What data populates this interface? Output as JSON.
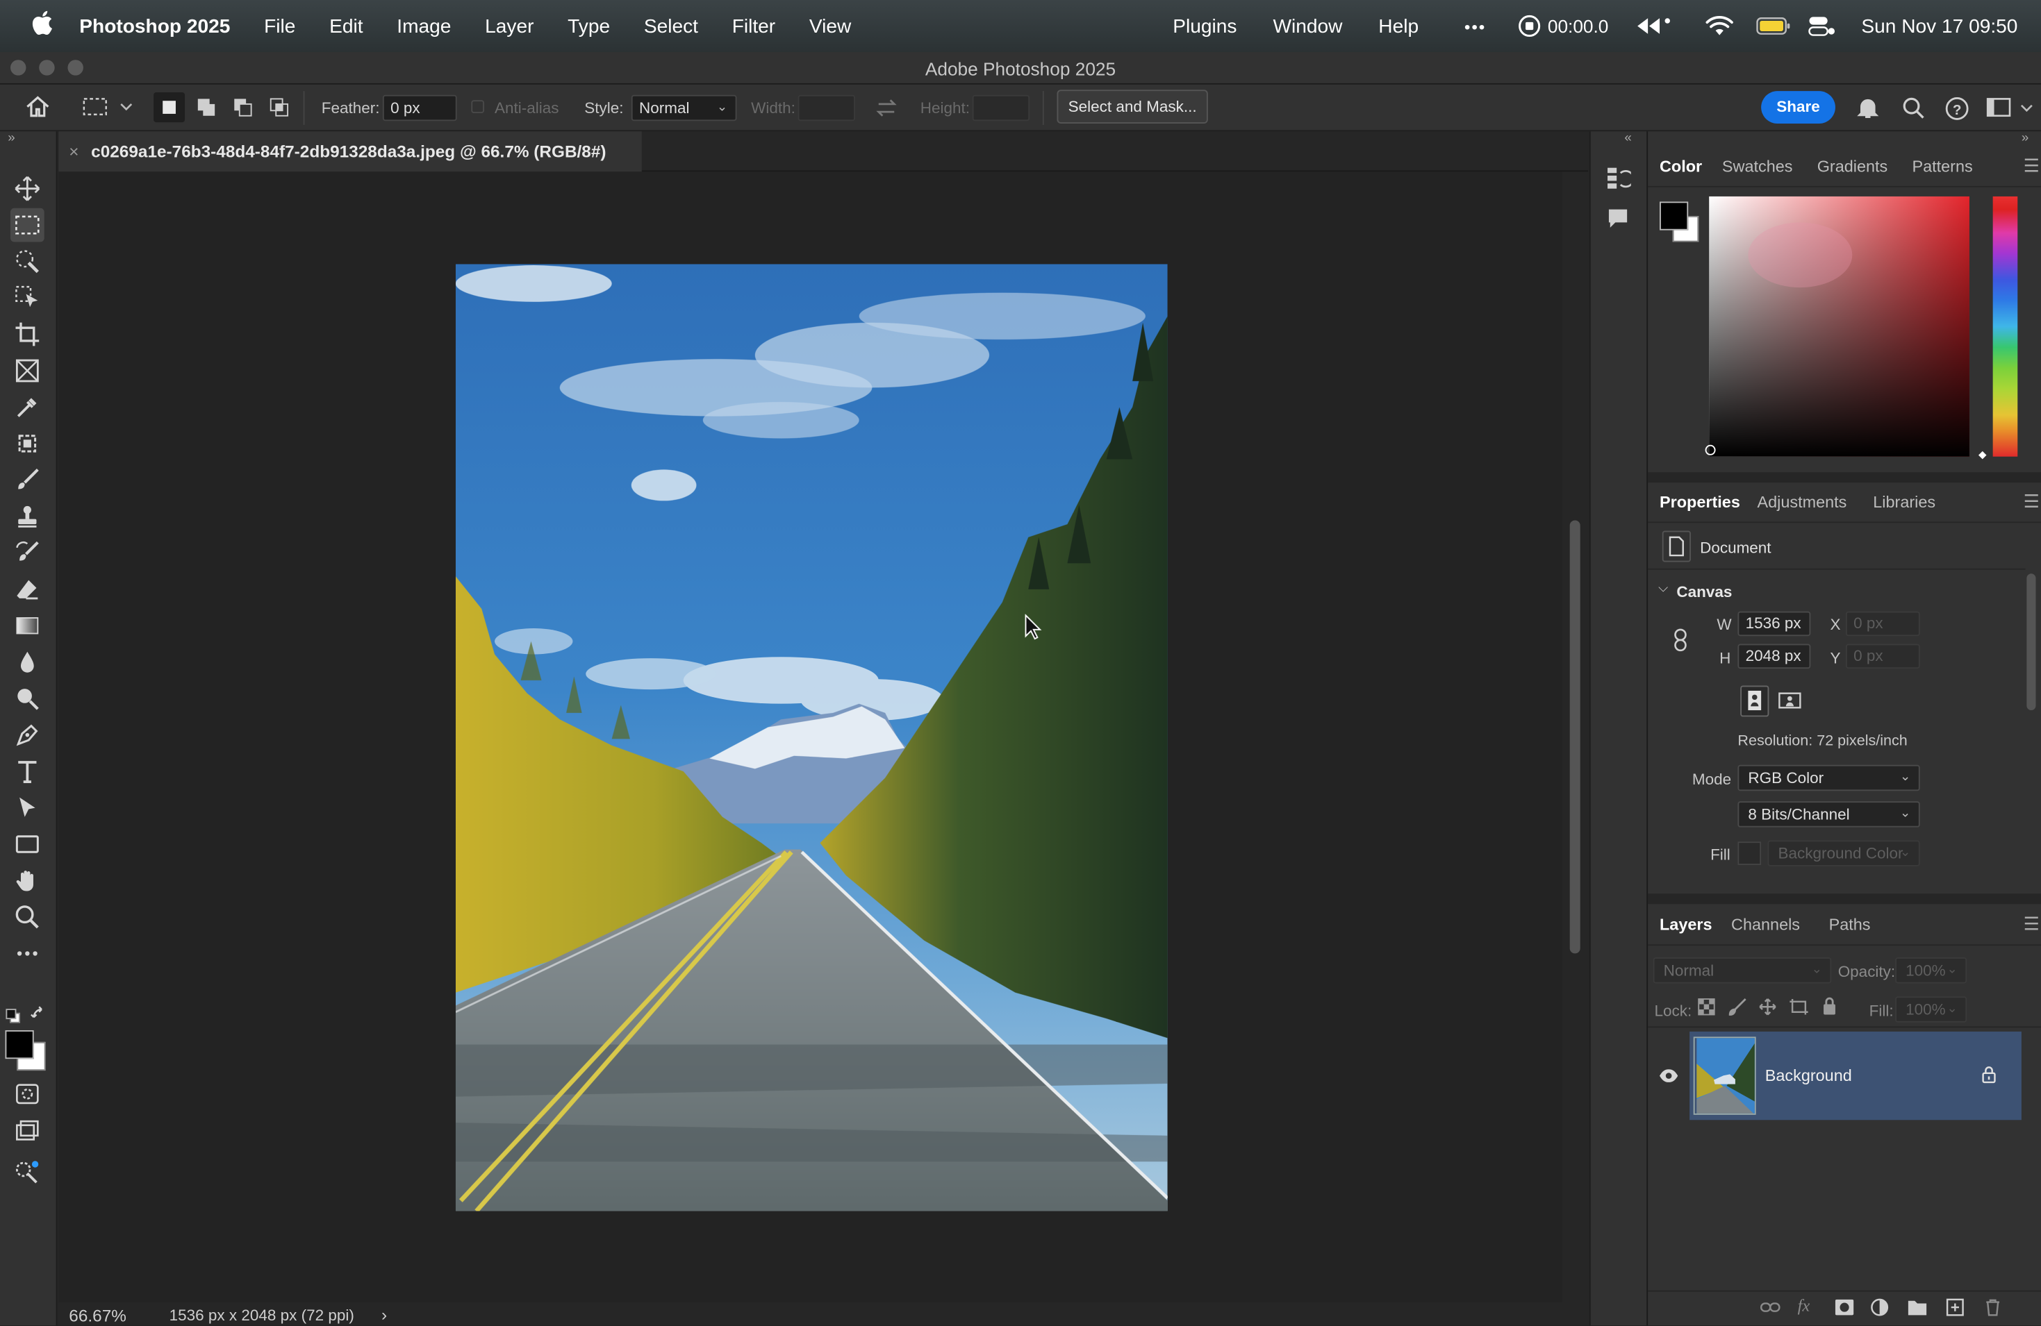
{
  "menubar": {
    "apple": "",
    "app": "Photoshop 2025",
    "items": [
      "File",
      "Edit",
      "Image",
      "Layer",
      "Type",
      "Select",
      "Filter",
      "View"
    ],
    "right_items": [
      "Plugins",
      "Window",
      "Help"
    ],
    "more": "•••",
    "record_time": "00:00.0",
    "datetime": "Sun Nov 17  09:50"
  },
  "titlebar": {
    "title": "Adobe Photoshop 2025"
  },
  "options": {
    "feather_label": "Feather:",
    "feather_value": "0 px",
    "antialias_label": "Anti-alias",
    "style_label": "Style:",
    "style_value": "Normal",
    "width_label": "Width:",
    "height_label": "Height:",
    "select_mask": "Select and Mask...",
    "share": "Share"
  },
  "document": {
    "tab_title": "c0269a1e-76b3-48d4-84f7-2db91328da3a.jpeg @ 66.7% (RGB/8#)",
    "close": "×"
  },
  "status": {
    "zoom": "66.67%",
    "info": "1536 px x 2048 px (72 ppi)",
    "arrow": "›"
  },
  "color_panel": {
    "tabs": [
      "Color",
      "Swatches",
      "Gradients",
      "Patterns"
    ]
  },
  "properties": {
    "tabs": [
      "Properties",
      "Adjustments",
      "Libraries"
    ],
    "doc_label": "Document",
    "canvas_label": "Canvas",
    "w_label": "W",
    "w_value": "1536 px",
    "h_label": "H",
    "h_value": "2048 px",
    "x_label": "X",
    "x_placeholder": "0 px",
    "y_label": "Y",
    "y_placeholder": "0 px",
    "resolution": "Resolution: 72 pixels/inch",
    "mode_label": "Mode",
    "mode_value": "RGB Color",
    "bits_value": "8 Bits/Channel",
    "fill_label": "Fill",
    "fill_value": "Background Color"
  },
  "layers": {
    "tabs": [
      "Layers",
      "Channels",
      "Paths"
    ],
    "blend": "Normal",
    "opacity_label": "Opacity:",
    "opacity_value": "100%",
    "lock_label": "Lock:",
    "fill_label": "Fill:",
    "fill_value": "100%",
    "layer_name": "Background"
  },
  "colors": {
    "accent": "#1473e6",
    "layer_selected": "#3d5273",
    "panel": "#323232"
  }
}
